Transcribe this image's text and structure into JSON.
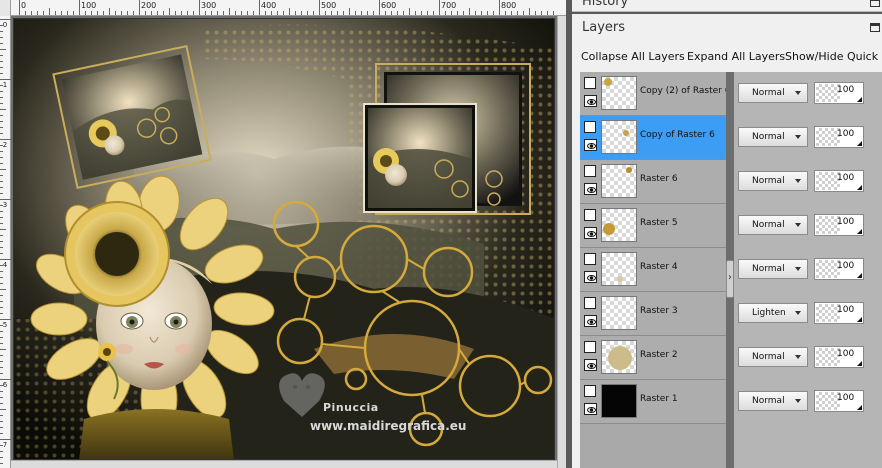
{
  "ruler": {
    "top_labels": [
      "0",
      "100",
      "200",
      "300",
      "400",
      "500",
      "600",
      "700",
      "800"
    ],
    "left_labels": [
      "0",
      "1",
      "2",
      "3",
      "4",
      "5",
      "6",
      "7"
    ]
  },
  "canvas": {
    "watermark_line1": "Pinuccia",
    "watermark_line2": "www.maidiregrafica.eu"
  },
  "history": {
    "title": "History"
  },
  "layers": {
    "title": "Layers",
    "toolbar": {
      "collapse": "Collapse All Layers",
      "expand": "Expand All Layers",
      "show_hide": "Show/Hide Quick S"
    },
    "items": [
      {
        "name": "Copy (2) of Raster 6",
        "mode": "Normal",
        "opacity": "100",
        "selected": false
      },
      {
        "name": "Copy of Raster 6",
        "mode": "Normal",
        "opacity": "100",
        "selected": true
      },
      {
        "name": "Raster 6",
        "mode": "Normal",
        "opacity": "100",
        "selected": false
      },
      {
        "name": "Raster 5",
        "mode": "Normal",
        "opacity": "100",
        "selected": false
      },
      {
        "name": "Raster 4",
        "mode": "Normal",
        "opacity": "100",
        "selected": false
      },
      {
        "name": "Raster 3",
        "mode": "Lighten",
        "opacity": "100",
        "selected": false
      },
      {
        "name": "Raster 2",
        "mode": "Normal",
        "opacity": "100",
        "selected": false
      },
      {
        "name": "Raster 1",
        "mode": "Normal",
        "opacity": "100",
        "selected": false
      }
    ]
  },
  "colors": {
    "selection": "#3d9cf3",
    "gold": "#d4aa3c",
    "panel_bg": "#f0f0f0"
  }
}
